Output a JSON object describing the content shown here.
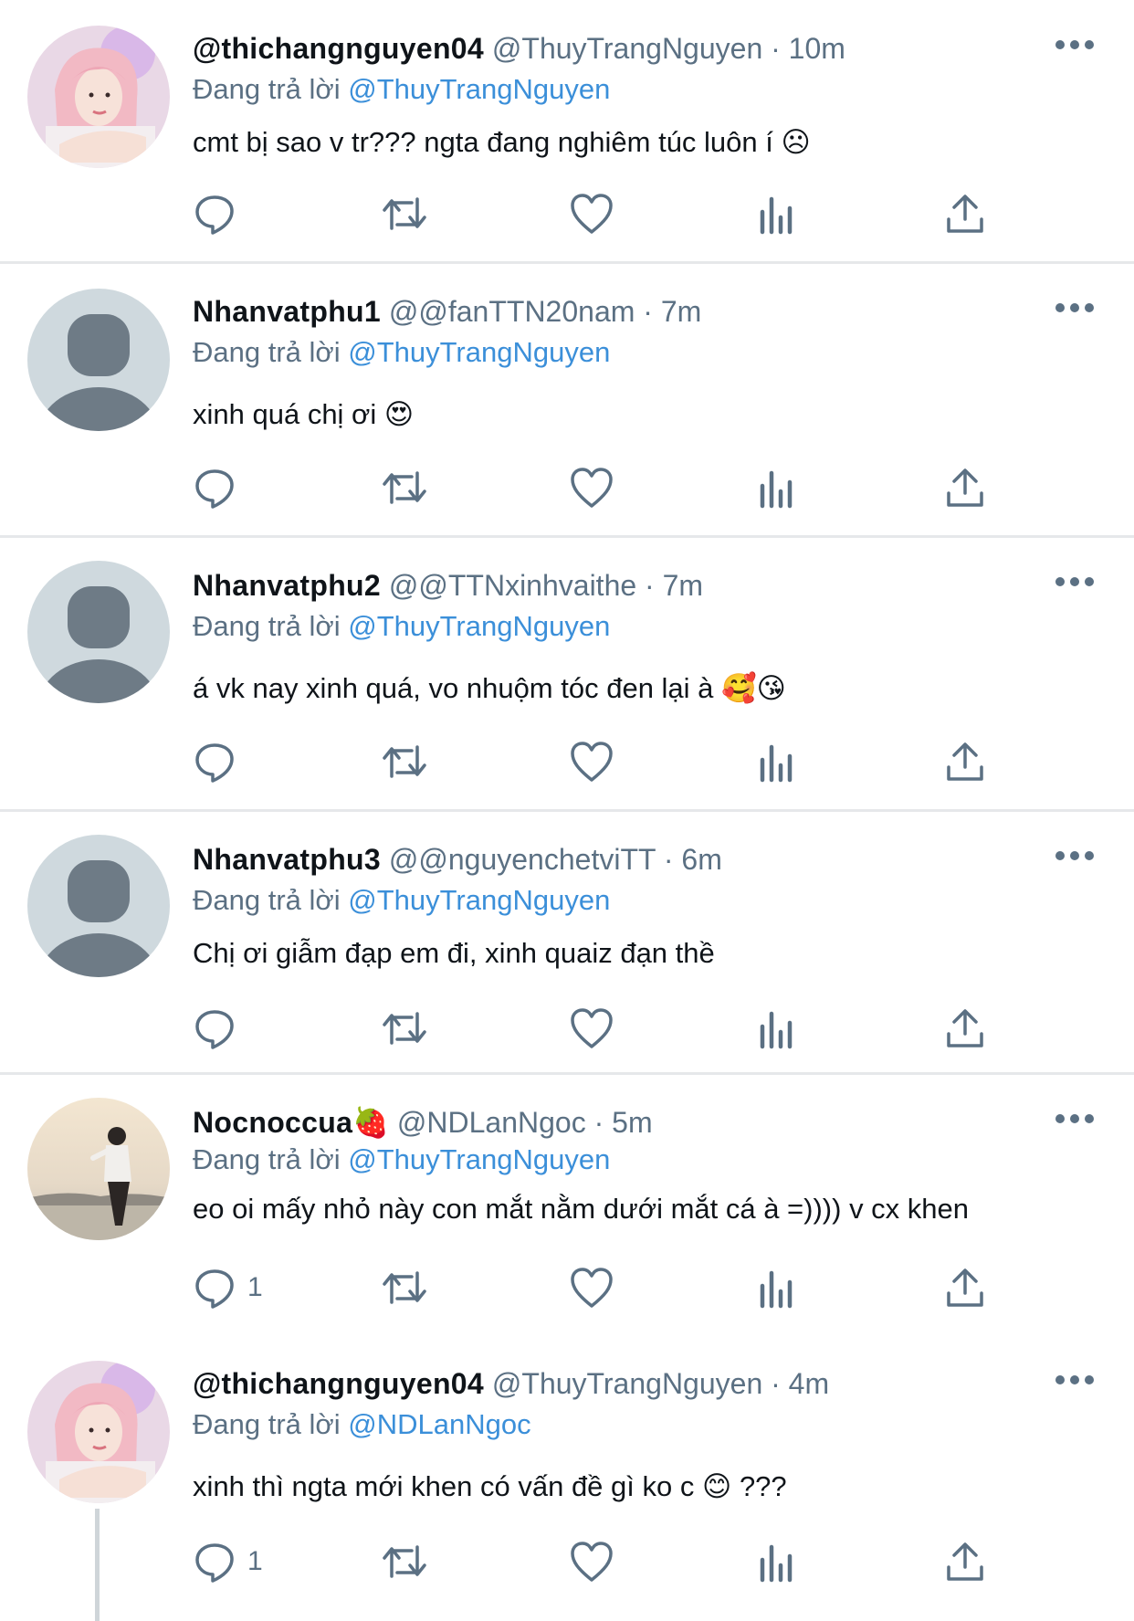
{
  "tweets": [
    {
      "name": "@thichangnguyen04",
      "handle": "@ThuyTrangNguyen",
      "time": "10m",
      "reply_prefix": "Đang trả lời",
      "reply_to": "@ThuyTrangNguyen",
      "text": "cmt bị sao v tr??? ngta đang nghiêm túc luôn í",
      "emoji_after_text": "☹",
      "reply_count": "",
      "avatar": "photo-pink-hair"
    },
    {
      "name": "Nhanvatphu1",
      "handle": "@@fanTTN20nam",
      "time": "7m",
      "reply_prefix": "Đang trả lời",
      "reply_to": "@ThuyTrangNguyen",
      "text": "xinh quá chị ơi",
      "emoji_after_text": "😍",
      "reply_count": "",
      "avatar": "default-avatar"
    },
    {
      "name": "Nhanvatphu2",
      "handle": "@@TTNxinhvaithe",
      "time": "7m",
      "reply_prefix": "Đang trả lời",
      "reply_to": "@ThuyTrangNguyen",
      "text": "á vk nay xinh quá, vo nhuộm tóc đen lại à",
      "emoji_after_text": "🥰😘",
      "reply_count": "",
      "avatar": "default-avatar"
    },
    {
      "name": "Nhanvatphu3",
      "handle": "@@nguyenchetviTT",
      "time": "6m",
      "reply_prefix": "Đang trả lời",
      "reply_to": "@ThuyTrangNguyen",
      "text": "Chị ơi giẫm đạp em đi, xinh quaiz đạn thề",
      "emoji_after_text": "",
      "reply_count": "",
      "avatar": "default-avatar"
    },
    {
      "name": "Nocnoccua",
      "name_emoji": "🍓",
      "handle": "@NDLanNgoc",
      "time": "5m",
      "reply_prefix": "Đang trả lời",
      "reply_to": "@ThuyTrangNguyen",
      "text": "eo oi mấy nhỏ này con mắt nằm dưới mắt cá à =)))) v cx khen",
      "emoji_after_text": "",
      "reply_count": "1",
      "avatar": "photo-sunset"
    },
    {
      "name": "@thichangnguyen04",
      "handle": "@ThuyTrangNguyen",
      "time": "4m",
      "reply_prefix": "Đang trả lời",
      "reply_to": "@NDLanNgoc",
      "text": "xinh thì ngta mới khen có vấn đề gì ko c",
      "emoji_after_text": "😊",
      "text_suffix": "???",
      "reply_count": "1",
      "avatar": "photo-pink-hair"
    }
  ],
  "separator": "·",
  "icons": [
    "reply-icon",
    "retweet-icon",
    "like-icon",
    "views-icon",
    "share-icon",
    "more-icon"
  ],
  "colors": {
    "handle_gray": "#5b7083",
    "mention_blue": "#3b8fd9",
    "divider": "#e6e8ea"
  }
}
